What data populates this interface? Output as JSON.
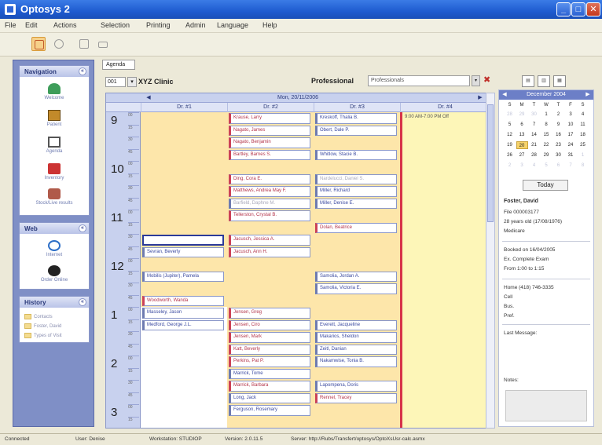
{
  "window": {
    "title": "Optosys 2"
  },
  "menu": [
    "File",
    "Edit",
    "Actions",
    "Selection",
    "Printing",
    "Admin",
    "Language",
    "Help"
  ],
  "navigation": {
    "header": "Navigation",
    "items": [
      "Welcome",
      "Patient",
      "Agenda",
      "Inventory",
      "Stock/Live results"
    ]
  },
  "web": {
    "header": "Web",
    "items": [
      "Internet",
      "Order Online"
    ]
  },
  "history": {
    "header": "History",
    "items": [
      "Contacts",
      "Foster, David",
      "Types of Visit"
    ]
  },
  "main": {
    "tab": "Agenda",
    "clinic_select": "001",
    "clinic_name": "XYZ Clinic",
    "professional_label": "Professional",
    "professional_value": "Professionals"
  },
  "calendar": {
    "date": "Mon, 20/11/2006",
    "columns": [
      "Dr. #1",
      "Dr. #2",
      "Dr. #3",
      "Dr. #4"
    ],
    "hours": [
      "9",
      "10",
      "11",
      "12",
      "1",
      "2",
      "3"
    ],
    "slots": [
      "00",
      "15",
      "30",
      "45"
    ],
    "col4_note": "9:00 AM-7:00 PM Off",
    "col1": [
      {
        "slot": 10,
        "text": "",
        "style": "sel"
      },
      {
        "slot": 11,
        "text": "Sevran, Beverly",
        "style": ""
      },
      {
        "slot": 13,
        "text": "Mobilis (Jupiter), Pamela",
        "style": ""
      },
      {
        "slot": 15,
        "text": "Woodworth, Wanda",
        "style": "red"
      },
      {
        "slot": 16,
        "text": "Masseley, Jason",
        "style": ""
      },
      {
        "slot": 17,
        "text": "Medford, George J.L.",
        "style": ""
      }
    ],
    "col2": [
      {
        "slot": 0,
        "text": "Krause, Larry",
        "style": "red"
      },
      {
        "slot": 1,
        "text": "Nagato, James",
        "style": "red"
      },
      {
        "slot": 2,
        "text": "Nagato, Benjamin",
        "style": "red"
      },
      {
        "slot": 3,
        "text": "Bartley, Barnes S.",
        "style": "red"
      },
      {
        "slot": 5,
        "text": "Ding, Cora E.",
        "style": "red"
      },
      {
        "slot": 6,
        "text": "Matthews, Andrea May F.",
        "style": "red"
      },
      {
        "slot": 7,
        "text": "Barfield, Daphne M.",
        "style": "gray"
      },
      {
        "slot": 8,
        "text": "Tellerston, Crystal B.",
        "style": "red"
      },
      {
        "slot": 10,
        "text": "Jacusch, Jessica A.",
        "style": "red"
      },
      {
        "slot": 11,
        "text": "Jacusch, Ann H.",
        "style": "red"
      },
      {
        "slot": 16,
        "text": "Jensen, Greg",
        "style": "red"
      },
      {
        "slot": 17,
        "text": "Jensen, Ciro",
        "style": "red"
      },
      {
        "slot": 18,
        "text": "Jensen, Mark",
        "style": "red"
      },
      {
        "slot": 19,
        "text": "Katt, Beverly",
        "style": "red"
      },
      {
        "slot": 20,
        "text": "Perkins, Pat P.",
        "style": "red"
      },
      {
        "slot": 21,
        "text": "Marrick, Tome",
        "style": ""
      },
      {
        "slot": 22,
        "text": "Marrick, Barbara",
        "style": "red"
      },
      {
        "slot": 23,
        "text": "Long, Jack",
        "style": ""
      },
      {
        "slot": 24,
        "text": "Ferguson, Rosemary",
        "style": ""
      }
    ],
    "col3": [
      {
        "slot": 0,
        "text": "Kreskoff, Thalia B.",
        "style": ""
      },
      {
        "slot": 1,
        "text": "Obert, Dale P.",
        "style": ""
      },
      {
        "slot": 3,
        "text": "Whitlow, Stacie B.",
        "style": ""
      },
      {
        "slot": 5,
        "text": "Nardelucci, Daniel S.",
        "style": "gray"
      },
      {
        "slot": 6,
        "text": "Miller, Richard",
        "style": ""
      },
      {
        "slot": 7,
        "text": "Miller, Denise E.",
        "style": ""
      },
      {
        "slot": 9,
        "text": "Dolan, Beatrice",
        "style": "red"
      },
      {
        "slot": 13,
        "text": "Samolia, Jordan A.",
        "style": ""
      },
      {
        "slot": 14,
        "text": "Samolia, Victoria E.",
        "style": ""
      },
      {
        "slot": 17,
        "text": "Everett, Jacqueline",
        "style": ""
      },
      {
        "slot": 18,
        "text": "Makarios, Sheldon",
        "style": ""
      },
      {
        "slot": 19,
        "text": "Zeitl, Danian",
        "style": ""
      },
      {
        "slot": 20,
        "text": "Nakamwise, Tonia B.",
        "style": ""
      },
      {
        "slot": 22,
        "text": "Lapompena, Doris",
        "style": ""
      },
      {
        "slot": 23,
        "text": "Rennel, Tracey",
        "style": "red"
      }
    ]
  },
  "mini_calendar": {
    "month": "December 2004",
    "weekdays": [
      "S",
      "M",
      "T",
      "W",
      "T",
      "F",
      "S"
    ],
    "weeks": [
      [
        "28",
        "29",
        "30",
        "1",
        "2",
        "3",
        "4"
      ],
      [
        "5",
        "6",
        "7",
        "8",
        "9",
        "10",
        "11"
      ],
      [
        "12",
        "13",
        "14",
        "15",
        "16",
        "17",
        "18"
      ],
      [
        "19",
        "20",
        "21",
        "22",
        "23",
        "24",
        "25"
      ],
      [
        "26",
        "27",
        "28",
        "29",
        "30",
        "31",
        "1"
      ],
      [
        "2",
        "3",
        "4",
        "5",
        "6",
        "7",
        "8"
      ]
    ],
    "today_button": "Today"
  },
  "patient": {
    "name": "Foster, David",
    "file": "File       000003177",
    "age": "28 years old (17/08/1976)",
    "plan": "Medicare",
    "booked": "Booked on     16/04/2005",
    "exam": "Ex.  Complete Exam",
    "time": "From  1:00  to  1:15",
    "phone_home": "Home     (418) 746-3335",
    "phone_cell": "Cell",
    "phone_bus": "Bus.",
    "phone_pref": "Pref.",
    "last_message": "Last Message:",
    "notes": "Notes:"
  },
  "statusbar": {
    "state": "Connected",
    "user": "User: Denise",
    "workstation": "Workstation: STUDIOP",
    "version": "Version: 2.0.11.5",
    "server": "Server: http://Rubs/Transfert/optosys/OptoXsUsr-calc.asmx"
  },
  "colors": {
    "accent": "#7f8fc6",
    "slot_yellow": "#fde6aa",
    "off_yellow": "#fdf6b8",
    "divider_red": "#d7344a"
  }
}
